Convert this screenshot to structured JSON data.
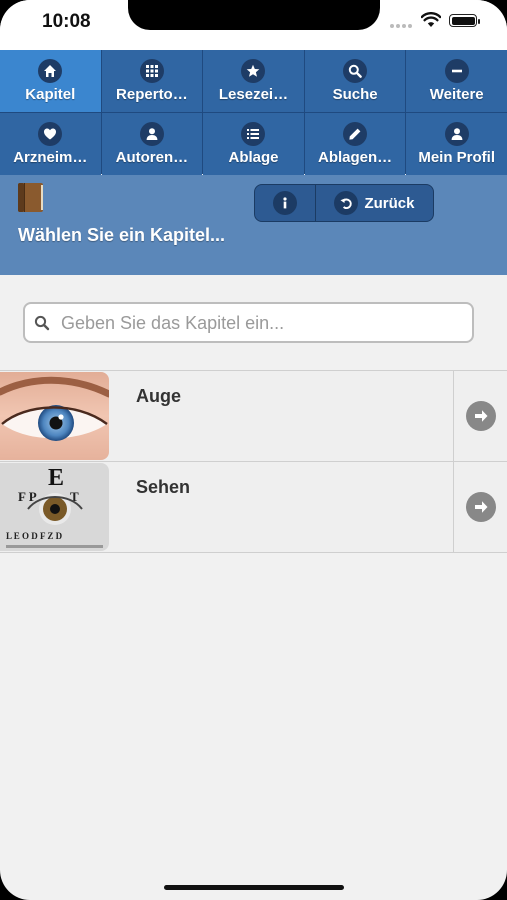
{
  "status": {
    "time": "10:08"
  },
  "nav": {
    "items": [
      {
        "label": "Kapitel",
        "icon": "home-icon"
      },
      {
        "label": "Reperto…",
        "icon": "grid-icon"
      },
      {
        "label": "Lesezei…",
        "icon": "star-icon"
      },
      {
        "label": "Suche",
        "icon": "search-icon"
      },
      {
        "label": "Weitere",
        "icon": "minus-icon"
      },
      {
        "label": "Arzneim…",
        "icon": "heart-icon"
      },
      {
        "label": "Autoren…",
        "icon": "user-icon"
      },
      {
        "label": "Ablage",
        "icon": "list-icon"
      },
      {
        "label": "Ablagen…",
        "icon": "pencil-icon"
      },
      {
        "label": "Mein Profil",
        "icon": "user-icon"
      }
    ],
    "active_index": 0
  },
  "header": {
    "title": "Wählen Sie ein Kapitel...",
    "back_label": "Zurück"
  },
  "search": {
    "placeholder": "Geben Sie das Kapitel ein..."
  },
  "chapters": [
    {
      "title": "Auge",
      "image": "eye-photo"
    },
    {
      "title": "Sehen",
      "image": "eye-chart-photo"
    }
  ],
  "colors": {
    "nav_bg": "#3066a3",
    "nav_active": "#3b86cf",
    "header_bg": "#5b87b9"
  }
}
